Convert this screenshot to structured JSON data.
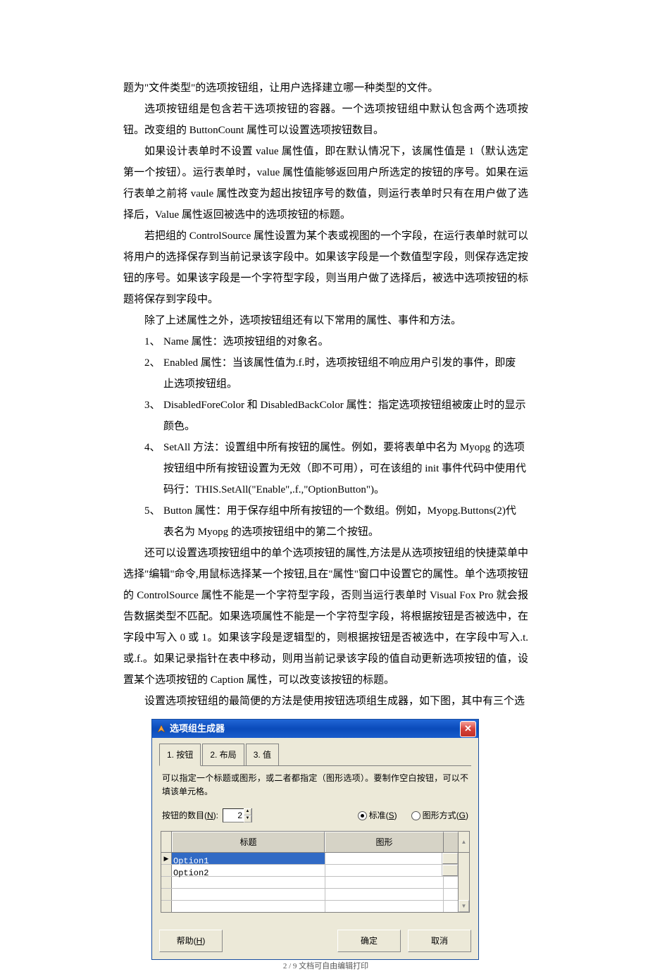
{
  "body": {
    "p1": "题为\"文件类型\"的选项按钮组，让用户选择建立哪一种类型的文件。",
    "p2": "选项按钮组是包含若干选项按钮的容器。一个选项按钮组中默认包含两个选项按钮。改变组的 ButtonCount 属性可以设置选项按钮数目。",
    "p3": "如果设计表单时不设置 value 属性值，即在默认情况下，该属性值是 1（默认选定第一个按钮）。运行表单时，value 属性值能够返回用户所选定的按钮的序号。如果在运行表单之前将 vaule 属性改变为超出按钮序号的数值，则运行表单时只有在用户做了选择后，Value 属性返回被选中的选项按钮的标题。",
    "p4": "若把组的 ControlSource 属性设置为某个表或视图的一个字段，在运行表单时就可以将用户的选择保存到当前记录该字段中。如果该字段是一个数值型字段，则保存选定按钮的序号。如果该字段是一个字符型字段，则当用户做了选择后，被选中选项按钮的标题将保存到字段中。",
    "p5": "除了上述属性之外，选项按钮组还有以下常用的属性、事件和方法。",
    "list": {
      "1": "Name 属性：选项按钮组的对象名。",
      "2a": "Enabled 属性：当该属性值为.f.时，选项按钮组不响应用户引发的事件，即废",
      "2b": "止选项按钮组。",
      "3a": "DisabledForeColor 和 DisabledBackColor 属性：指定选项按钮组被废止时的显示",
      "3b": "颜色。",
      "4a": "SetAll 方法：设置组中所有按钮的属性。例如，要将表单中名为 Myopg 的选项",
      "4b": "按钮组中所有按钮设置为无效（即不可用），可在该组的 init 事件代码中使用代",
      "4c": "码行：THIS.SetAll(\"Enable\",.f.,\"OptionButton\")。",
      "5a": "Button 属性：用于保存组中所有按钮的一个数组。例如，Myopg.Buttons(2)代",
      "5b": "表名为 Myopg 的选项按钮组中的第二个按钮。"
    },
    "p6": "还可以设置选项按钮组中的单个选项按钮的属性,方法是从选项按钮组的快捷菜单中选择\"编辑\"命令,用鼠标选择某一个按钮,且在\"属性\"窗口中设置它的属性。单个选项按钮的 ControlSource 属性不能是一个字符型字段，否则当运行表单时 Visual Fox Pro 就会报告数据类型不匹配。如果选项属性不能是一个字符型字段，将根据按钮是否被选中，在字段中写入 0 或 1。如果该字段是逻辑型的，则根据按钮是否被选中，在字段中写入.t.或.f.。如果记录指针在表中移动，则用当前记录该字段的值自动更新选项按钮的值，设置某个选项按钮的 Caption 属性，可以改变该按钮的标题。",
    "p7": "设置选项按钮组的最简便的方法是使用按钮选项组生成器，如下图，其中有三个选"
  },
  "dialog": {
    "title": "选项组生成器",
    "tabs": {
      "t1": "1. 按钮",
      "t2": "2. 布局",
      "t3": "3. 值"
    },
    "hint": "可以指定一个标题或图形，或二者都指定（图形选项）。要制作空白按钮，可以不填该单元格。",
    "count_label": "按钮的数目(N):",
    "count_value": "2",
    "radio_standard": "标准(S)",
    "radio_graphic": "图形方式(G)",
    "col_title": "标题",
    "col_graphic": "图形",
    "rows": {
      "r1": "Option1",
      "r2": "Option2"
    },
    "help": "帮助(H)",
    "ok": "确定",
    "cancel": "取消"
  },
  "footer": "2 / 9 文档可自由编辑打印"
}
